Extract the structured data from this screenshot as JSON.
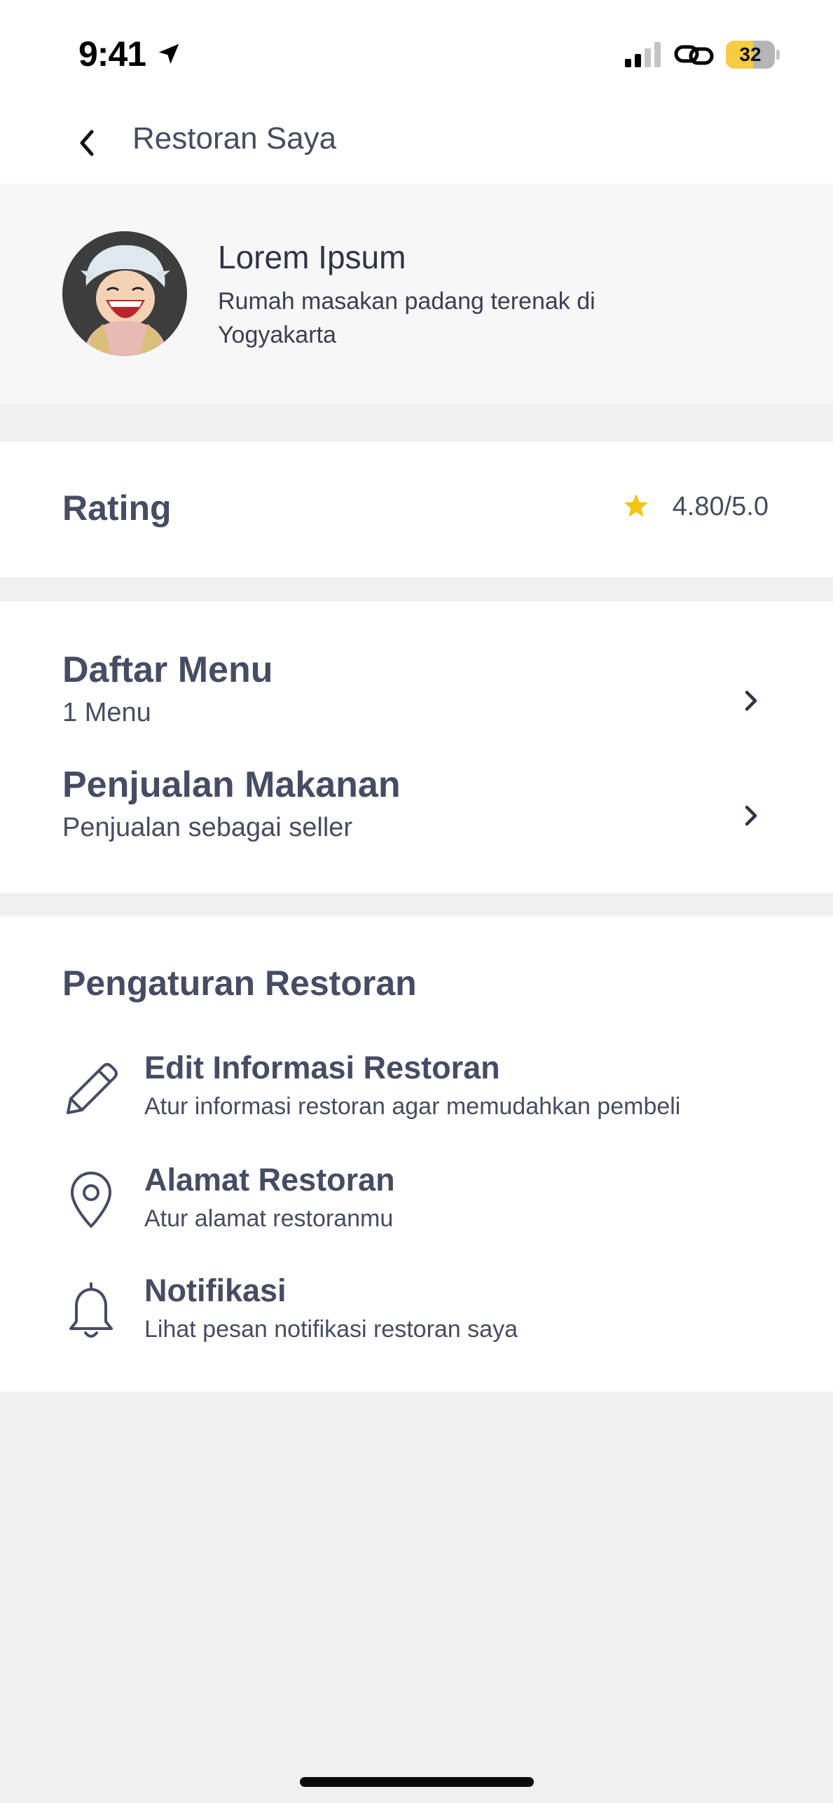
{
  "status_bar": {
    "time": "9:41",
    "battery_level": "32",
    "battery_fraction": 0.55,
    "icons": [
      "location-arrow-icon",
      "signal-icon",
      "link-icon",
      "battery-icon"
    ]
  },
  "header": {
    "title": "Restoran Saya",
    "back_icon": "chevron-left-icon"
  },
  "profile": {
    "name": "Lorem Ipsum",
    "description": "Rumah masakan padang terenak di Yogyakarta"
  },
  "rating": {
    "label": "Rating",
    "value": "4.80/5.0",
    "star_color": "#f2c512"
  },
  "menu": {
    "items": [
      {
        "title": "Daftar Menu",
        "subtitle": "1 Menu"
      },
      {
        "title": "Penjualan Makanan",
        "subtitle": "Penjualan sebagai seller"
      }
    ]
  },
  "settings": {
    "title": "Pengaturan Restoran",
    "items": [
      {
        "title": "Edit Informasi Restoran",
        "subtitle": "Atur informasi restoran agar memudahkan pembeli",
        "icon": "pencil-icon"
      },
      {
        "title": "Alamat Restoran",
        "subtitle": "Atur alamat restoranmu",
        "icon": "map-pin-icon"
      },
      {
        "title": "Notifikasi",
        "subtitle": "Lihat pesan notifikasi restoran saya",
        "icon": "bell-icon"
      }
    ]
  },
  "colors": {
    "text_primary": "#464c63",
    "background": "#f0f0f0",
    "card": "#ffffff",
    "battery_yellow": "#f6cc45"
  }
}
